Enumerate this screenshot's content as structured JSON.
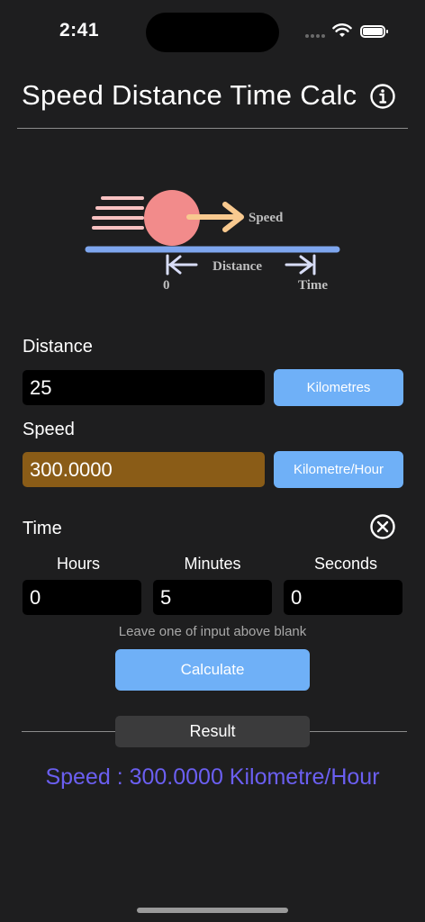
{
  "status_bar": {
    "time": "2:41"
  },
  "header": {
    "title": "Speed Distance Time Calc"
  },
  "illustration": {
    "speed_label": "Speed",
    "distance_label": "Distance",
    "zero_label": "0",
    "time_label": "Time"
  },
  "distance": {
    "label": "Distance",
    "value": "25",
    "unit": "Kilometres"
  },
  "speed": {
    "label": "Speed",
    "value": "300.0000",
    "unit": "Kilometre/Hour"
  },
  "time": {
    "label": "Time",
    "columns": [
      {
        "label": "Hours",
        "value": "0"
      },
      {
        "label": "Minutes",
        "value": "5"
      },
      {
        "label": "Seconds",
        "value": "0"
      }
    ]
  },
  "hint": "Leave one of input above blank",
  "calculate_label": "Calculate",
  "result": {
    "badge": "Result",
    "text": "Speed : 300.0000 Kilometre/Hour"
  },
  "colors": {
    "background": "#1e1e1f",
    "accent_button": "#6fb0f7",
    "computed_field": "#8a5c17",
    "result_text": "#6b5ff1",
    "ball": "#f28b8b",
    "speed_lines": "#f9c2c2",
    "speed_arrow": "#f8c98f",
    "ground": "#7ea6ee",
    "measure_arrows": "#d8ddf7"
  }
}
